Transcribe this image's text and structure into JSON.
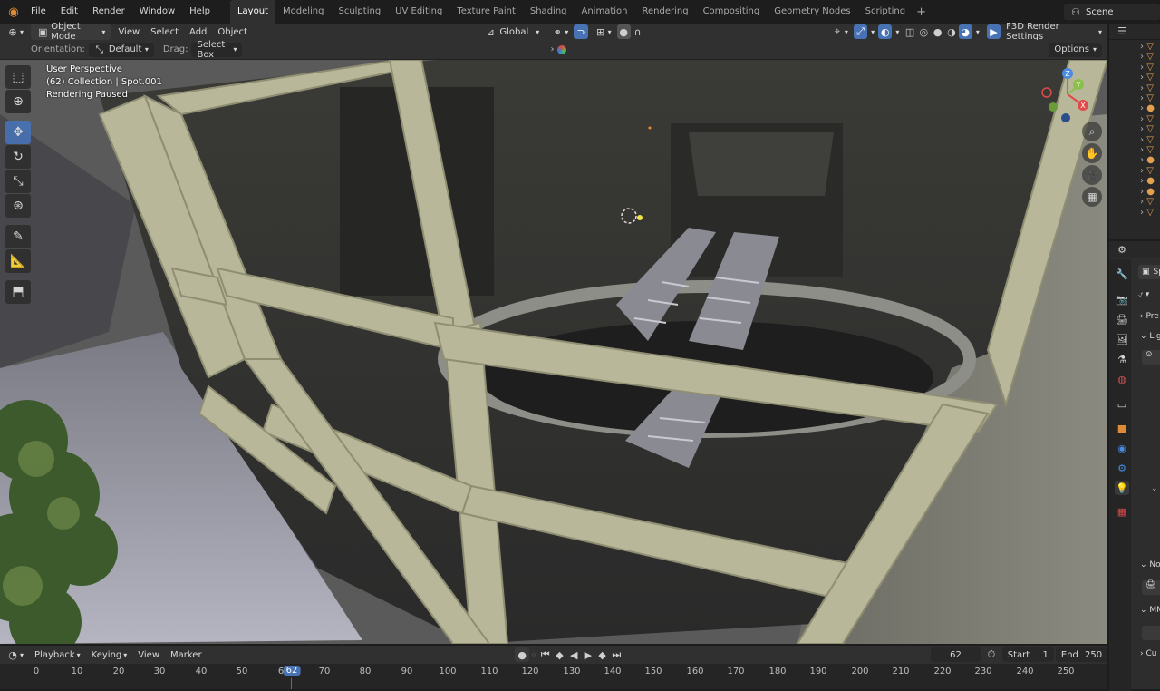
{
  "menubar": {
    "items": [
      "File",
      "Edit",
      "Render",
      "Window",
      "Help"
    ],
    "workspaces": [
      "Layout",
      "Modeling",
      "Sculpting",
      "UV Editing",
      "Texture Paint",
      "Shading",
      "Animation",
      "Rendering",
      "Compositing",
      "Geometry Nodes",
      "Scripting"
    ],
    "active_workspace": "Layout",
    "scene": "Scene"
  },
  "header": {
    "mode": "Object Mode",
    "menus": [
      "View",
      "Select",
      "Add",
      "Object"
    ],
    "transform_orientation": "Global",
    "render_settings": "F3D Render Settings"
  },
  "tool_settings": {
    "orientation_label": "Orientation:",
    "orientation_value": "Default",
    "drag_label": "Drag:",
    "drag_value": "Select Box",
    "options": "Options"
  },
  "viewport": {
    "perspective": "User Perspective",
    "collection": "(62) Collection | Spot.001",
    "status": "Rendering Paused",
    "gizmo_axes": [
      "X",
      "Y",
      "Z"
    ]
  },
  "properties_panel": {
    "object_name_stub": "Sp",
    "section_1": "Pre",
    "section_2": "Lig",
    "section_3": "No",
    "section_4": "MM",
    "section_5": "Cu"
  },
  "timeline": {
    "menus": [
      "Playback",
      "Keying",
      "View",
      "Marker"
    ],
    "current_frame": "62",
    "start_label": "Start",
    "start": "1",
    "end_label": "End",
    "end": "250",
    "ticks": [
      "0",
      "10",
      "20",
      "30",
      "40",
      "50",
      "6",
      "62",
      "70",
      "80",
      "90",
      "100",
      "110",
      "120",
      "130",
      "140",
      "150",
      "160",
      "170",
      "180",
      "190",
      "200",
      "210",
      "220",
      "230",
      "240",
      "250"
    ]
  }
}
